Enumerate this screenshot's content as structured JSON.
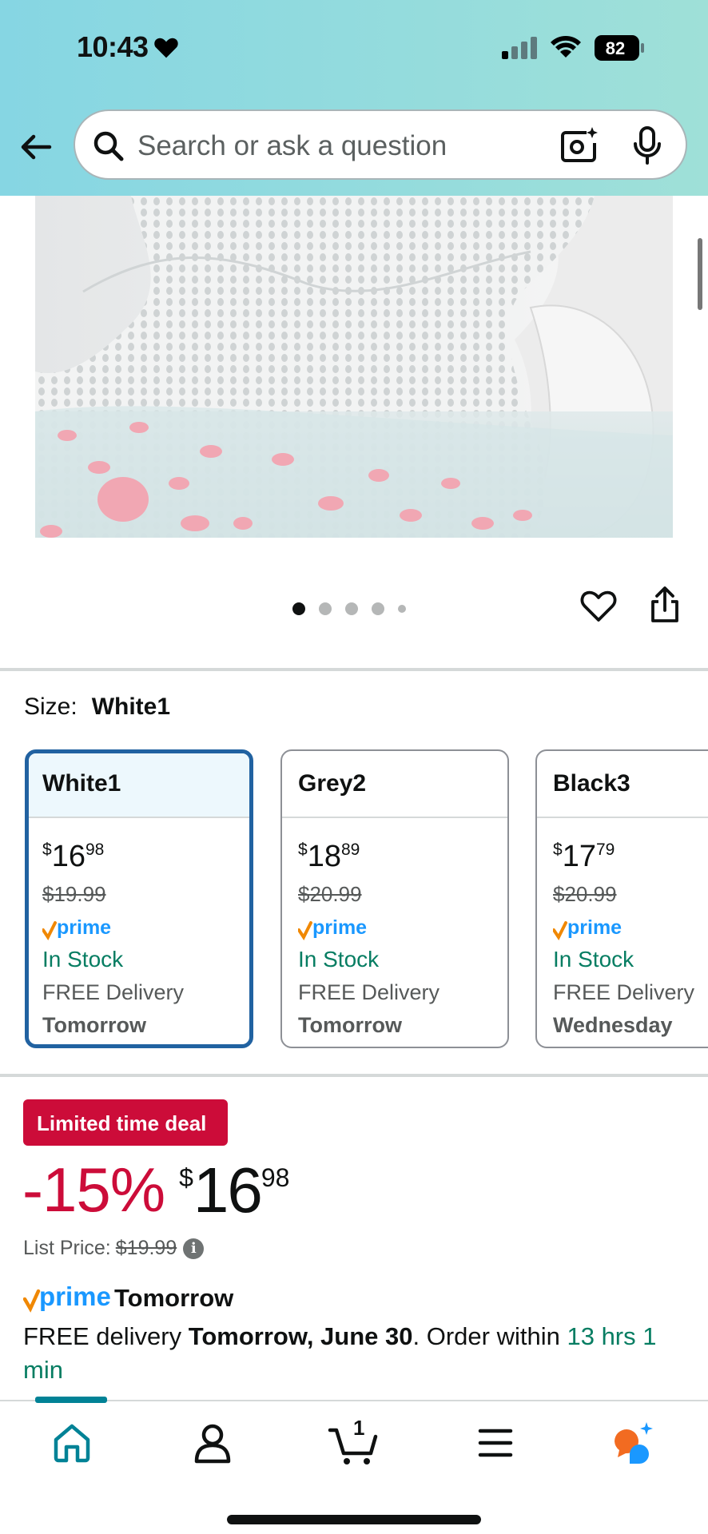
{
  "status_bar": {
    "time": "10:43",
    "battery": "82"
  },
  "search": {
    "placeholder": "Search or ask a question"
  },
  "carousel": {
    "total": 5,
    "active": 1
  },
  "size": {
    "label": "Size:",
    "selected": "White1"
  },
  "variants": [
    {
      "name": "White1",
      "price_whole": "16",
      "price_cents": "98",
      "list_price": "$19.99",
      "prime": "prime",
      "stock": "In Stock",
      "delivery": "FREE Delivery",
      "day": "Tomorrow"
    },
    {
      "name": "Grey2",
      "price_whole": "18",
      "price_cents": "89",
      "list_price": "$20.99",
      "prime": "prime",
      "stock": "In Stock",
      "delivery": "FREE Delivery",
      "day": "Tomorrow"
    },
    {
      "name": "Black3",
      "price_whole": "17",
      "price_cents": "79",
      "list_price": "$20.99",
      "prime": "prime",
      "stock": "In Stock",
      "delivery": "FREE Delivery",
      "day": "Wednesday"
    }
  ],
  "deal": {
    "badge": "Limited time deal",
    "discount": "-15%",
    "currency": "$",
    "price_whole": "16",
    "price_cents": "98",
    "list_label": "List Price:",
    "list_price": "$19.99"
  },
  "delivery": {
    "prime_word": "prime",
    "prime_day": "Tomorrow",
    "prefix": "FREE delivery ",
    "date": "Tomorrow, June 30",
    "middle": ". Order within ",
    "countdown": "13 hrs 1 min"
  },
  "bottom_nav": {
    "items": [
      "home",
      "account",
      "cart",
      "menu",
      "rufus"
    ],
    "cart_count": "1"
  },
  "colors": {
    "accent": "#008296",
    "deal_red": "#cc0c39",
    "prime_blue": "#1a98ff",
    "stock_green": "#067d62",
    "selected_border": "#2162a1"
  }
}
